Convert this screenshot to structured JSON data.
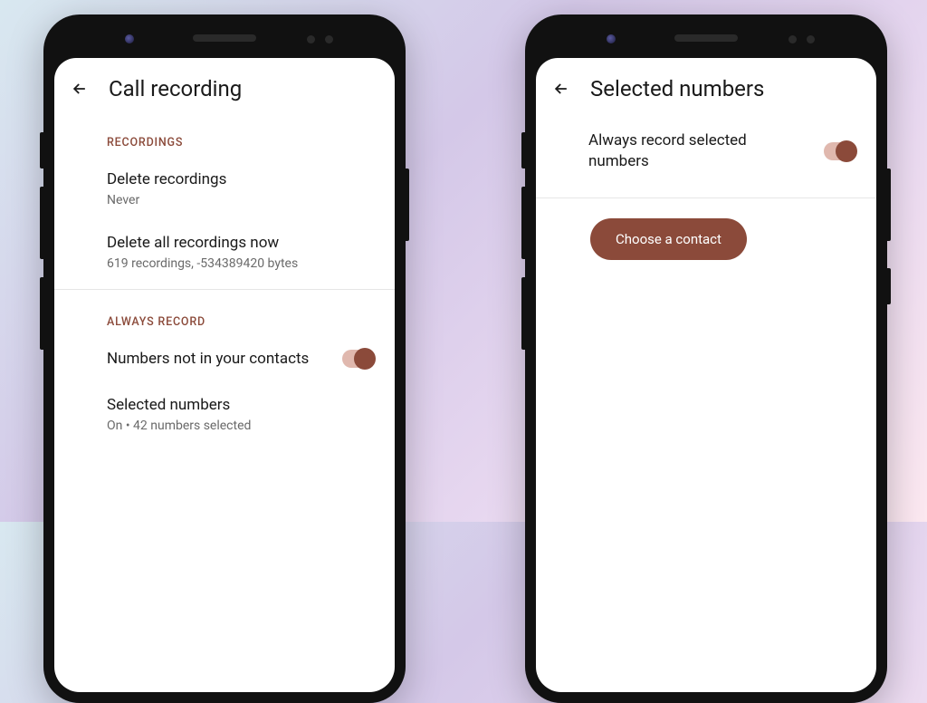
{
  "leftPhone": {
    "header": {
      "title": "Call recording"
    },
    "sections": {
      "recordings": {
        "label": "RECORDINGS",
        "deleteRecordings": {
          "title": "Delete recordings",
          "sub": "Never"
        },
        "deleteAllNow": {
          "title": "Delete all recordings now",
          "sub": "619 recordings, -534389420 bytes"
        }
      },
      "alwaysRecord": {
        "label": "ALWAYS RECORD",
        "notInContacts": {
          "title": "Numbers not in your contacts",
          "toggle": true
        },
        "selectedNumbers": {
          "title": "Selected numbers",
          "sub": "On • 42 numbers selected"
        }
      }
    }
  },
  "rightPhone": {
    "header": {
      "title": "Selected numbers"
    },
    "toggleRow": {
      "title": "Always record selected numbers",
      "toggle": true
    },
    "button": {
      "label": "Choose a contact"
    }
  },
  "colors": {
    "accent": "#8b4a3a"
  }
}
